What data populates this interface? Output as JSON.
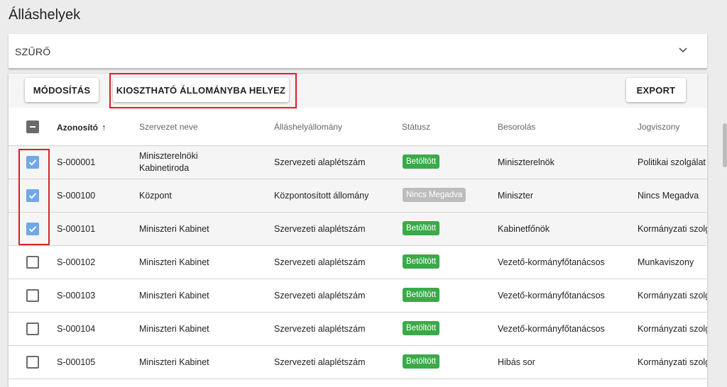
{
  "page": {
    "title": "Álláshelyek"
  },
  "filter": {
    "label": "SZŰRŐ",
    "chevron_icon": "chevron-down-icon"
  },
  "toolbar": {
    "modify_label": "MÓDOSÍTÁS",
    "assign_label": "KIOSZTHATÓ ÁLLOMÁNYBA HELYEZ",
    "export_label": "EXPORT"
  },
  "table": {
    "columns": {
      "id": "Azonosító",
      "org": "Szervezet neve",
      "pool": "Álláshelyállomány",
      "status": "Státusz",
      "grade": "Besorolás",
      "relation": "Jogviszony"
    },
    "sort_icon": "arrow-up-icon",
    "rows": [
      {
        "checked": true,
        "id": "S-000001",
        "org": "Miniszterelnöki Kabinetiroda",
        "pool": "Szervezeti alaplétszám",
        "status": "Betöltött",
        "status_color": "#3aaa48",
        "grade": "Miniszterelnök",
        "relation": "Politikai szolgálat"
      },
      {
        "checked": true,
        "id": "S-000100",
        "org": "Központ",
        "pool": "Központosított állomány",
        "status": "Nincs Megadva",
        "status_color": "#bdbdbd",
        "grade": "Miniszter",
        "relation": "Nincs Megadva"
      },
      {
        "checked": true,
        "id": "S-000101",
        "org": "Miniszteri Kabinet",
        "pool": "Szervezeti alaplétszám",
        "status": "Betöltött",
        "status_color": "#3aaa48",
        "grade": "Kabinetfőnök",
        "relation": "Kormányzati szolg"
      },
      {
        "checked": false,
        "id": "S-000102",
        "org": "Miniszteri Kabinet",
        "pool": "Szervezeti alaplétszám",
        "status": "Betöltött",
        "status_color": "#3aaa48",
        "grade": "Vezető-kormányfőtanácsos",
        "relation": "Munkaviszony"
      },
      {
        "checked": false,
        "id": "S-000103",
        "org": "Miniszteri Kabinet",
        "pool": "Szervezeti alaplétszám",
        "status": "Betöltött",
        "status_color": "#3aaa48",
        "grade": "Vezető-kormányfőtanácsos",
        "relation": "Kormányzati szolg"
      },
      {
        "checked": false,
        "id": "S-000104",
        "org": "Miniszteri Kabinet",
        "pool": "Szervezeti alaplétszám",
        "status": "Betöltött",
        "status_color": "#3aaa48",
        "grade": "Vezető-kormányfőtanácsos",
        "relation": "Kormányzati szolg"
      },
      {
        "checked": false,
        "id": "S-000105",
        "org": "Miniszteri Kabinet",
        "pool": "Szervezeti alaplétszám",
        "status": "Betöltött",
        "status_color": "#3aaa48",
        "grade": "Hibás sor",
        "relation": "Kormányzati szolg"
      }
    ]
  },
  "colors": {
    "highlight": "#d9202a",
    "checkbox_checked": "#6fa8e8"
  }
}
